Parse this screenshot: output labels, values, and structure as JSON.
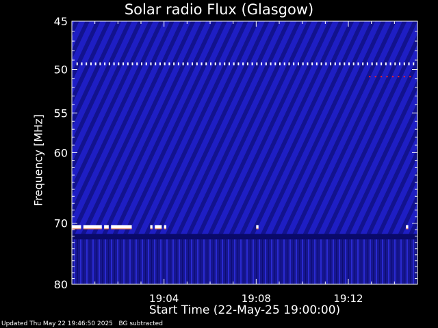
{
  "chart_data": {
    "type": "heatmap",
    "title": "Solar radio Flux (Glasgow)",
    "xlabel": "Start Time (22-May-25 19:00:00)",
    "ylabel": "Frequency [MHz]",
    "y_axis": {
      "scale": "log",
      "range": [
        45,
        80
      ],
      "inverted": true,
      "ticks": [
        45,
        50,
        55,
        60,
        70,
        80
      ]
    },
    "x_axis": {
      "range_minutes": [
        0,
        15
      ],
      "start": "19:00",
      "ticks": [
        "19:04",
        "19:08",
        "19:12"
      ],
      "tick_minutes": [
        4,
        8,
        12
      ]
    },
    "background_color": "#1a1ab0",
    "features": [
      {
        "label": "narrowband interference",
        "frequency_mhz": 49.4,
        "style": "dashed",
        "color": "#ffffff",
        "from_min": 0.2,
        "to_min": 14.9
      },
      {
        "label": "interference bursts",
        "frequency_mhz": 70.5,
        "color": "#ffffff",
        "segments_min": [
          [
            0.0,
            0.4
          ],
          [
            0.5,
            1.3
          ],
          [
            1.4,
            1.6
          ],
          [
            1.7,
            2.6
          ],
          [
            3.4,
            3.5
          ],
          [
            3.6,
            3.9
          ],
          [
            4.0,
            4.1
          ],
          [
            8.0,
            8.1
          ],
          [
            14.5,
            14.6
          ]
        ]
      },
      {
        "label": "weak red signal",
        "frequency_mhz": 50.8,
        "color": "#ff2020",
        "from_min": 12.9,
        "to_min": 14.8
      }
    ]
  },
  "footer": {
    "updated": "Updated Thu May 22 19:46:50 2025",
    "note": "BG subtracted"
  }
}
